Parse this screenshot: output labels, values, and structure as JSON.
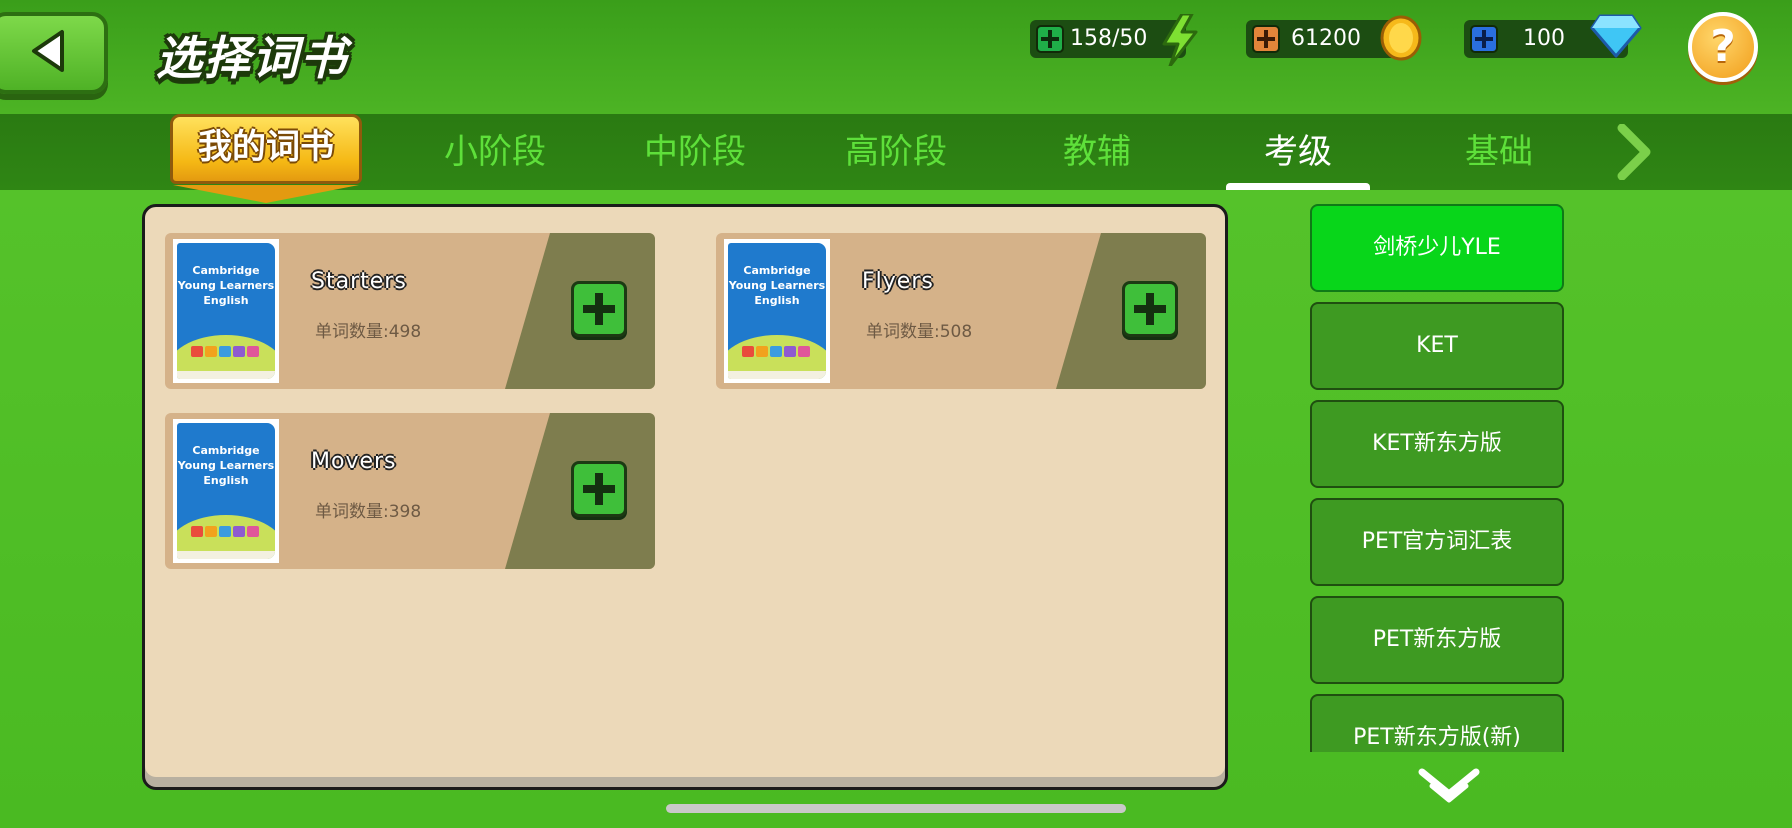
{
  "header": {
    "title": "选择词书",
    "resources": {
      "energy": "158/50",
      "coins": "61200",
      "gems": "100"
    },
    "help_label": "?"
  },
  "tabs": {
    "my_books": "我的词书",
    "items": [
      "小阶段",
      "中阶段",
      "高阶段",
      "教辅",
      "考级",
      "基础"
    ],
    "active": "考级"
  },
  "books": [
    {
      "name": "Starters",
      "count": "单词数量:498",
      "cover": [
        "Cambridge",
        "Young Learners",
        "English"
      ]
    },
    {
      "name": "Flyers",
      "count": "单词数量:508",
      "cover": [
        "Cambridge",
        "Young Learners",
        "English"
      ]
    },
    {
      "name": "Movers",
      "count": "单词数量:398",
      "cover": [
        "Cambridge",
        "Young Learners",
        "English"
      ]
    }
  ],
  "categories": [
    "剑桥少儿YLE",
    "KET",
    "KET新东方版",
    "PET官方词汇表",
    "PET新东方版",
    "PET新东方版(新)"
  ],
  "active_category": "剑桥少儿YLE",
  "colors": {
    "background": "#4cb324",
    "accent_gold": "#f5b814",
    "active_category": "#08d61a",
    "card": "#d5b289"
  }
}
